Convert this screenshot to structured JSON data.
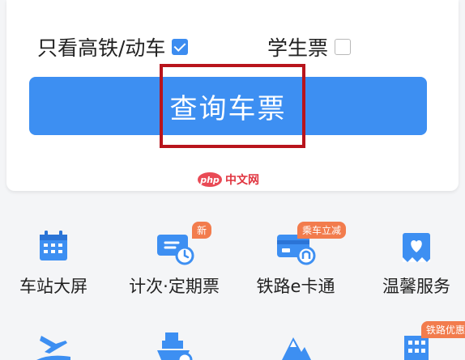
{
  "options": {
    "high_speed_label": "只看高铁/动车",
    "high_speed_checked": true,
    "student_label": "学生票",
    "student_checked": false
  },
  "query_button": {
    "label": "查询车票"
  },
  "watermark": {
    "logo": "php",
    "text": "中文网"
  },
  "services": [
    {
      "label": "车站大屏",
      "icon": "calendar-icon",
      "badge": ""
    },
    {
      "label": "计次·定期票",
      "icon": "ticket-clock-icon",
      "badge": "新"
    },
    {
      "label": "铁路e卡通",
      "icon": "railway-card-icon",
      "badge": "乘车立减"
    },
    {
      "label": "温馨服务",
      "icon": "heart-bag-icon",
      "badge": ""
    }
  ],
  "services_row2": [
    {
      "icon": "plane-train-icon"
    },
    {
      "icon": "ship-icon"
    },
    {
      "icon": "mountain-icon"
    },
    {
      "icon": "building-icon",
      "badge": "铁路优惠"
    }
  ],
  "colors": {
    "primary": "#3d8ff2",
    "highlight": "#b8141c",
    "badge": "#f27c4d"
  }
}
